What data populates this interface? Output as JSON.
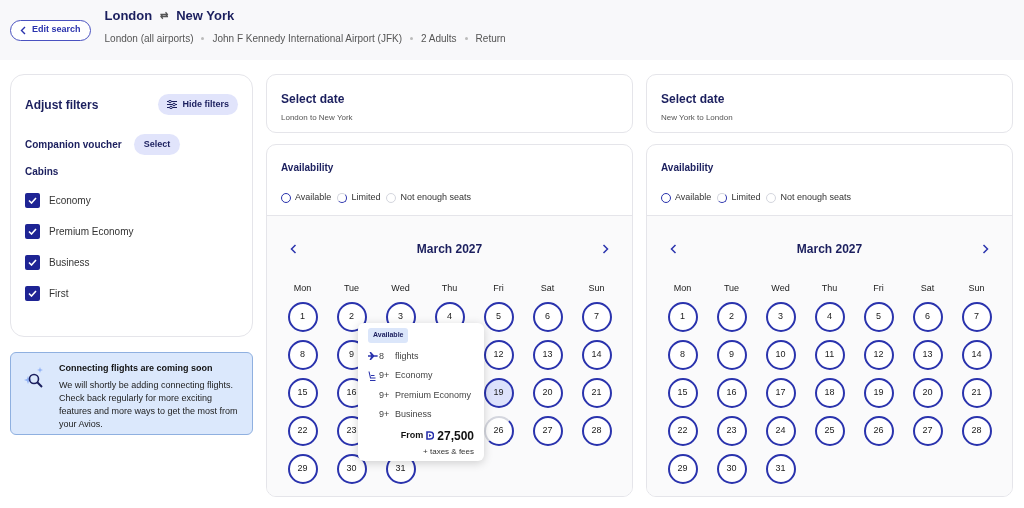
{
  "header": {
    "edit_button": "Edit search",
    "origin": "London",
    "swap_icon": "⇄",
    "destination": "New York",
    "details": [
      "London (all airports)",
      "John F Kennedy International Airport (JFK)",
      "2 Adults",
      "Return"
    ]
  },
  "filters": {
    "title": "Adjust filters",
    "hide_button": "Hide filters",
    "voucher_label": "Companion voucher",
    "voucher_button": "Select",
    "cabins_label": "Cabins",
    "cabins": [
      {
        "label": "Economy",
        "checked": true
      },
      {
        "label": "Premium Economy",
        "checked": true
      },
      {
        "label": "Business",
        "checked": true
      },
      {
        "label": "First",
        "checked": true
      }
    ]
  },
  "notice": {
    "title": "Connecting flights are coming soon",
    "text": "We will shortly be adding connecting flights. Check back regularly for more exciting features and more ways to get the most from your Avios."
  },
  "journeys": [
    {
      "title": "Select date",
      "route": "London to New York",
      "availability_title": "Availability",
      "legend": [
        {
          "label": "Available",
          "kind": "available"
        },
        {
          "label": "Limited",
          "kind": "limited"
        },
        {
          "label": "Not enough seats",
          "kind": "unavailable"
        }
      ],
      "month": "March 2027",
      "weekdays": [
        "Mon",
        "Tue",
        "Wed",
        "Thu",
        "Fri",
        "Sat",
        "Sun"
      ],
      "days": [
        {
          "label": "1",
          "kind": "available",
          "selected": false
        },
        {
          "label": "2",
          "kind": "available",
          "selected": false
        },
        {
          "label": "3",
          "kind": "available",
          "selected": false
        },
        {
          "label": "4",
          "kind": "available",
          "selected": false
        },
        {
          "label": "5",
          "kind": "available",
          "selected": false
        },
        {
          "label": "6",
          "kind": "available",
          "selected": false
        },
        {
          "label": "7",
          "kind": "available",
          "selected": false
        },
        {
          "label": "8",
          "kind": "available",
          "selected": false
        },
        {
          "label": "9",
          "kind": "available",
          "selected": false
        },
        {
          "kind": "covered"
        },
        {
          "kind": "covered"
        },
        {
          "label": "12",
          "kind": "available",
          "selected": false
        },
        {
          "label": "13",
          "kind": "available",
          "selected": false
        },
        {
          "label": "14",
          "kind": "available",
          "selected": false
        },
        {
          "label": "15",
          "kind": "available",
          "selected": false
        },
        {
          "label": "16",
          "kind": "available",
          "selected": false
        },
        {
          "kind": "covered"
        },
        {
          "kind": "covered"
        },
        {
          "label": "19",
          "kind": "available",
          "selected": true
        },
        {
          "label": "20",
          "kind": "available",
          "selected": false
        },
        {
          "label": "21",
          "kind": "available",
          "selected": false
        },
        {
          "label": "22",
          "kind": "available",
          "selected": false
        },
        {
          "label": "23",
          "kind": "available",
          "selected": false
        },
        {
          "kind": "covered"
        },
        {
          "kind": "covered"
        },
        {
          "label": "26",
          "kind": "limited",
          "selected": false
        },
        {
          "label": "27",
          "kind": "available",
          "selected": false
        },
        {
          "label": "28",
          "kind": "available",
          "selected": false
        },
        {
          "label": "29",
          "kind": "available",
          "selected": false
        },
        {
          "label": "30",
          "kind": "available",
          "selected": false
        },
        {
          "label": "31",
          "kind": "available",
          "selected": false
        }
      ],
      "tooltip": {
        "badge": "Available",
        "rows": [
          {
            "kind": "flights",
            "count": "8",
            "label": "flights"
          },
          {
            "kind": "seat",
            "count": "9+",
            "label": "Economy"
          },
          {
            "kind": "plain",
            "count": "9+",
            "label": "Premium Economy"
          },
          {
            "kind": "plain",
            "count": "9+",
            "label": "Business"
          }
        ],
        "from_label": "From",
        "price": "27,500",
        "note": "+ taxes & fees"
      }
    },
    {
      "title": "Select date",
      "route": "New York to London",
      "availability_title": "Availability",
      "legend": [
        {
          "label": "Available",
          "kind": "available"
        },
        {
          "label": "Limited",
          "kind": "limited"
        },
        {
          "label": "Not enough seats",
          "kind": "unavailable"
        }
      ],
      "month": "March 2027",
      "weekdays": [
        "Mon",
        "Tue",
        "Wed",
        "Thu",
        "Fri",
        "Sat",
        "Sun"
      ],
      "days": [
        {
          "label": "1",
          "kind": "available",
          "selected": false
        },
        {
          "label": "2",
          "kind": "available",
          "selected": false
        },
        {
          "label": "3",
          "kind": "available",
          "selected": false
        },
        {
          "label": "4",
          "kind": "available",
          "selected": false
        },
        {
          "label": "5",
          "kind": "available",
          "selected": false
        },
        {
          "label": "6",
          "kind": "available",
          "selected": false
        },
        {
          "label": "7",
          "kind": "available",
          "selected": false
        },
        {
          "label": "8",
          "kind": "available",
          "selected": false
        },
        {
          "label": "9",
          "kind": "available",
          "selected": false
        },
        {
          "label": "10",
          "kind": "available",
          "selected": false
        },
        {
          "label": "11",
          "kind": "available",
          "selected": false
        },
        {
          "label": "12",
          "kind": "available",
          "selected": false
        },
        {
          "label": "13",
          "kind": "available",
          "selected": false
        },
        {
          "label": "14",
          "kind": "available",
          "selected": false
        },
        {
          "label": "15",
          "kind": "available",
          "selected": false
        },
        {
          "label": "16",
          "kind": "available",
          "selected": false
        },
        {
          "label": "17",
          "kind": "available",
          "selected": false
        },
        {
          "label": "18",
          "kind": "available",
          "selected": false
        },
        {
          "label": "19",
          "kind": "available",
          "selected": false
        },
        {
          "label": "20",
          "kind": "available",
          "selected": false
        },
        {
          "label": "21",
          "kind": "available",
          "selected": false
        },
        {
          "label": "22",
          "kind": "available",
          "selected": false
        },
        {
          "label": "23",
          "kind": "available",
          "selected": false
        },
        {
          "label": "24",
          "kind": "available",
          "selected": false
        },
        {
          "label": "25",
          "kind": "available",
          "selected": false
        },
        {
          "label": "26",
          "kind": "available",
          "selected": false
        },
        {
          "label": "27",
          "kind": "available",
          "selected": false
        },
        {
          "label": "28",
          "kind": "available",
          "selected": false
        },
        {
          "label": "29",
          "kind": "available",
          "selected": false
        },
        {
          "label": "30",
          "kind": "available",
          "selected": false
        },
        {
          "label": "31",
          "kind": "available",
          "selected": false
        }
      ]
    }
  ]
}
